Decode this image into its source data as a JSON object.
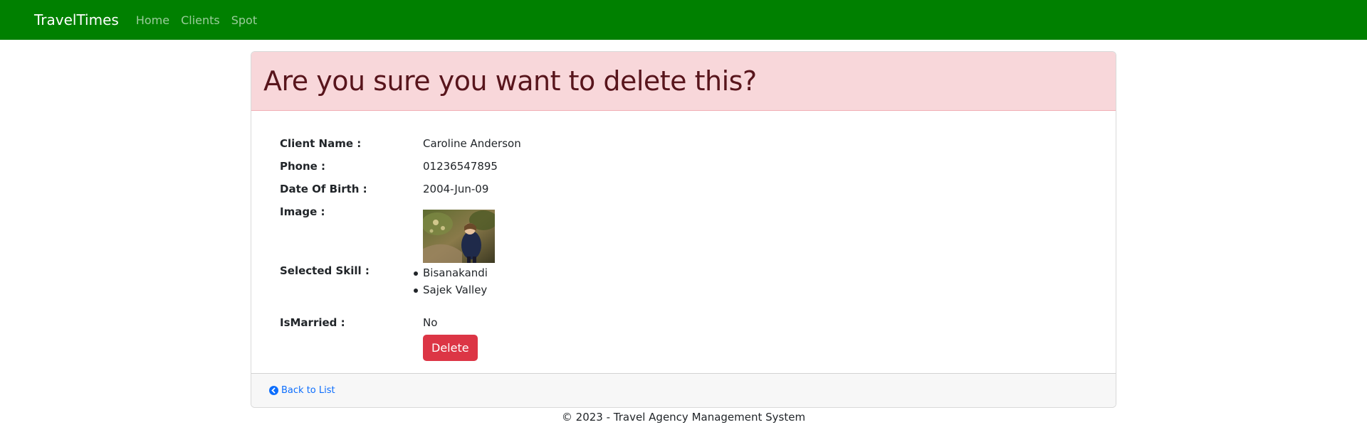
{
  "navbar": {
    "brand": "TravelTimes",
    "links": [
      "Home",
      "Clients",
      "Spot"
    ]
  },
  "header": {
    "title": "Are you sure you want to delete this?"
  },
  "details": {
    "client_name_label": "Client Name :",
    "client_name": "Caroline Anderson",
    "phone_label": "Phone :",
    "phone": "01236547895",
    "dob_label": "Date Of Birth :",
    "dob": "2004-Jun-09",
    "image_label": "Image :",
    "skills_label": "Selected Skill :",
    "skills": [
      "Bisanakandi",
      "Sajek Valley"
    ],
    "married_label": "IsMarried :",
    "married": "No"
  },
  "actions": {
    "delete_label": "Delete",
    "back_label": "Back to List"
  },
  "footer": {
    "text": "© 2023 - Travel Agency Management System"
  },
  "colors": {
    "navbar": "#008000",
    "danger": "#dc3545",
    "header_bg": "#f8d7da",
    "link": "#0d6efd"
  }
}
